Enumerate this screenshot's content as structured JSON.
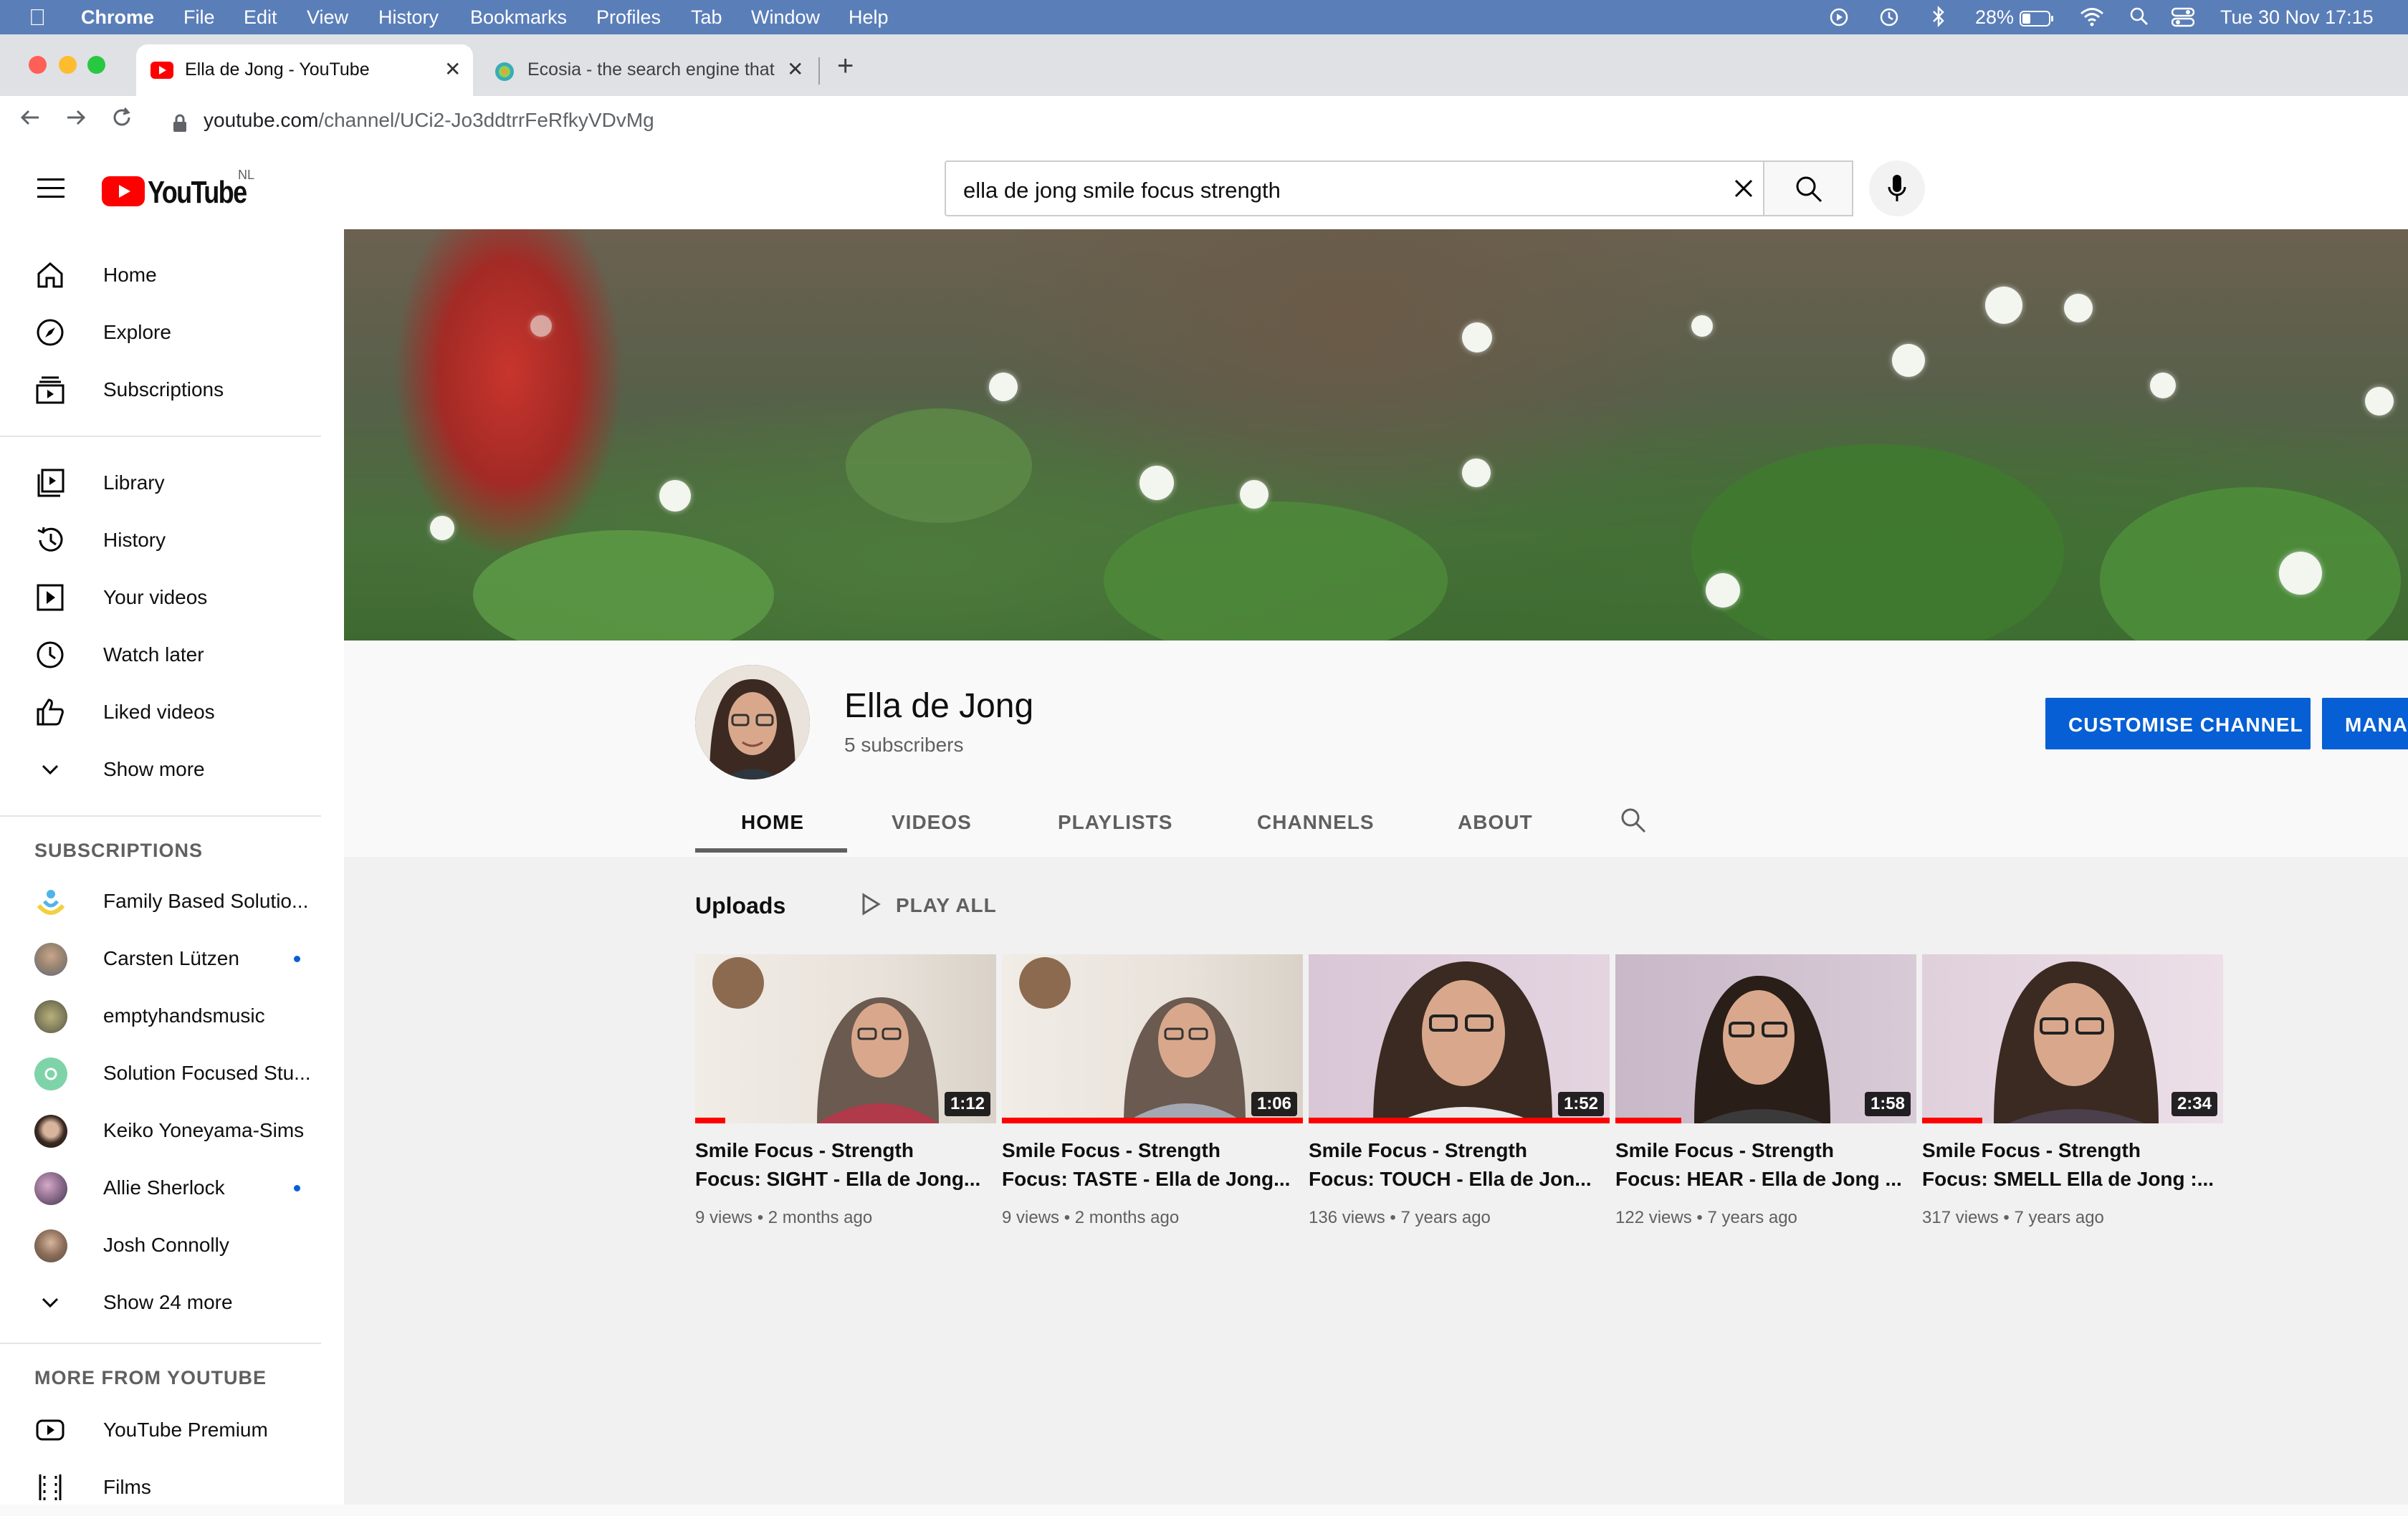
{
  "menubar": {
    "app": "Chrome",
    "items": [
      "File",
      "Edit",
      "View",
      "History",
      "Bookmarks",
      "Profiles",
      "Tab",
      "Window",
      "Help"
    ],
    "battery": "28%",
    "datetime": "Tue 30 Nov  17:15"
  },
  "tabs": [
    {
      "title": "Ella de Jong - YouTube",
      "active": true
    },
    {
      "title": "Ecosia - the search engine that",
      "active": false
    }
  ],
  "address": {
    "domain": "youtube.com",
    "path": "/channel/UCi2-Jo3ddtrrFeRfkyVDvMg"
  },
  "header": {
    "logo_text": "YouTube",
    "country": "NL",
    "search_value": "ella de jong smile focus strength"
  },
  "sidebar": {
    "main": [
      "Home",
      "Explore",
      "Subscriptions"
    ],
    "library": [
      "Library",
      "History",
      "Your videos",
      "Watch later",
      "Liked videos",
      "Show more"
    ],
    "subscriptions_heading": "SUBSCRIPTIONS",
    "subscriptions": [
      {
        "name": "Family Based Solutio...",
        "dot": false,
        "color": "#f4d03f"
      },
      {
        "name": "Carsten Lützen",
        "dot": true,
        "color": "#9a8570"
      },
      {
        "name": "emptyhandsmusic",
        "dot": false,
        "color": "#7d7a5a"
      },
      {
        "name": "Solution Focused Stu...",
        "dot": false,
        "color": "#7fd3a8"
      },
      {
        "name": "Keiko Yoneyama-Sims",
        "dot": false,
        "color": "#3a2a22"
      },
      {
        "name": "Allie Sherlock",
        "dot": true,
        "color": "#8a6a8a"
      },
      {
        "name": "Josh Connolly",
        "dot": false,
        "color": "#8c6e5a"
      }
    ],
    "show_more_subs": "Show 24 more",
    "more_heading": "MORE FROM YOUTUBE",
    "more": [
      "YouTube Premium",
      "Films"
    ]
  },
  "channel": {
    "name": "Ella de Jong",
    "subscribers": "5 subscribers",
    "customise_label": "CUSTOMISE CHANNEL",
    "manage_label": "MANA",
    "tabs": [
      "HOME",
      "VIDEOS",
      "PLAYLISTS",
      "CHANNELS",
      "ABOUT"
    ]
  },
  "uploads": {
    "heading": "Uploads",
    "play_all": "PLAY ALL",
    "videos": [
      {
        "line1": "Smile Focus - Strength",
        "line2": "Focus: SIGHT - Ella de Jong...",
        "duration": "1:12",
        "views": "9 views",
        "age": "2 months ago",
        "progress": 0.1
      },
      {
        "line1": "Smile Focus - Strength",
        "line2": "Focus: TASTE - Ella de Jong...",
        "duration": "1:06",
        "views": "9 views",
        "age": "2 months ago",
        "progress": 1.0
      },
      {
        "line1": "Smile Focus - Strength",
        "line2": "Focus: TOUCH - Ella de Jon...",
        "duration": "1:52",
        "views": "136 views",
        "age": "7 years ago",
        "progress": 1.0
      },
      {
        "line1": "Smile Focus - Strength",
        "line2": "Focus: HEAR - Ella de Jong ...",
        "duration": "1:58",
        "views": "122 views",
        "age": "7 years ago",
        "progress": 0.22
      },
      {
        "line1": "Smile Focus - Strength",
        "line2": "Focus: SMELL Ella de Jong :...",
        "duration": "2:34",
        "views": "317 views",
        "age": "7 years ago",
        "progress": 0.2
      }
    ]
  },
  "colors": {
    "accent": "#065fd4",
    "youtube_red": "#ff0000",
    "menubar": "#5a7eb8"
  }
}
